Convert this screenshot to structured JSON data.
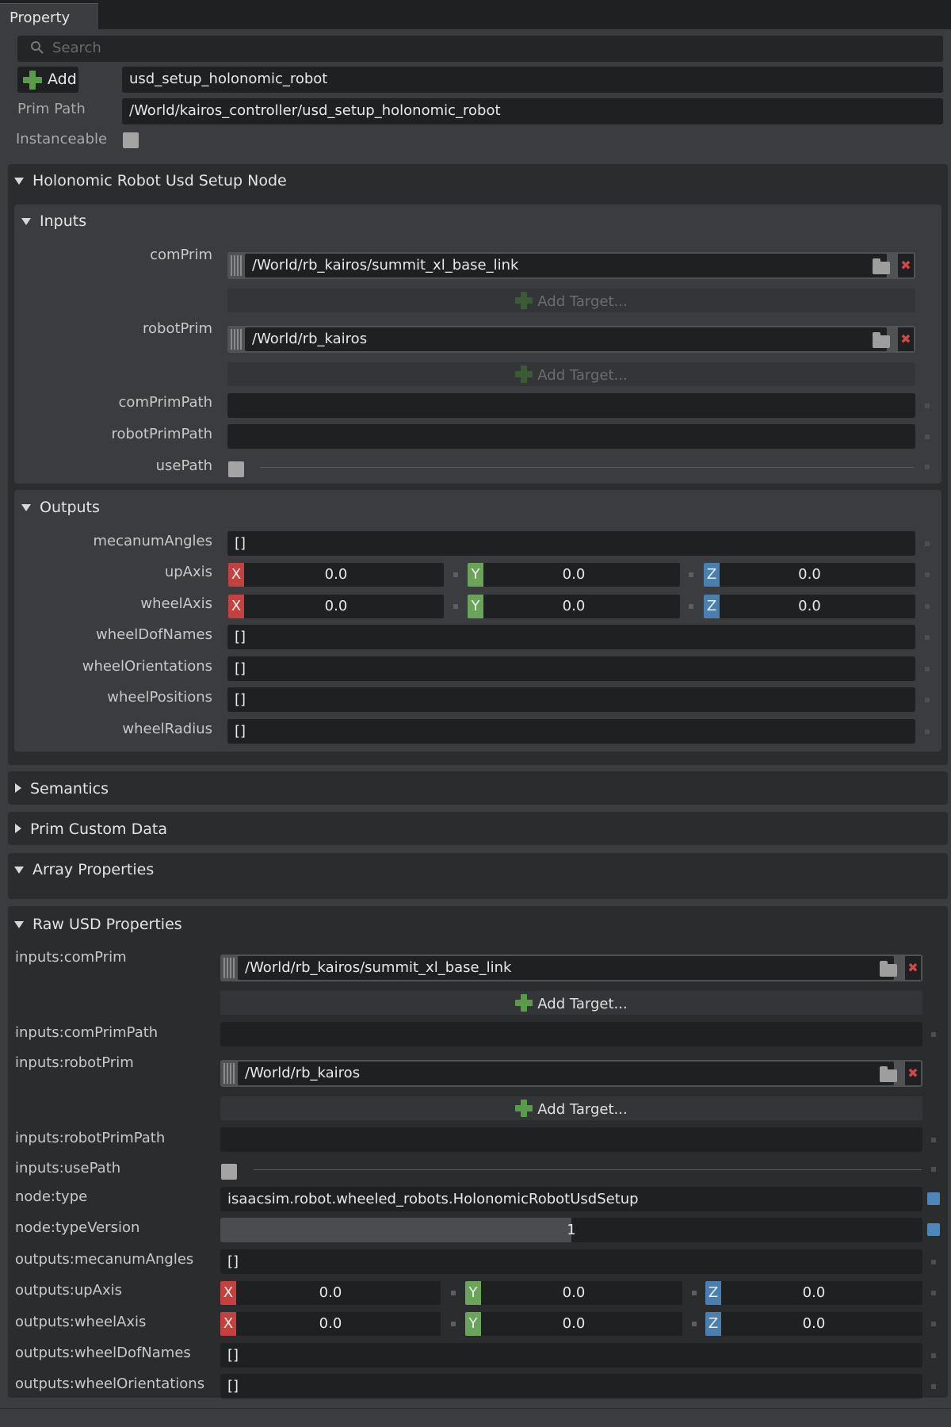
{
  "window": {
    "tab_label": "Property"
  },
  "header": {
    "search_placeholder": "Search",
    "add_label": "Add",
    "prim_name": "usd_setup_holonomic_robot",
    "prim_path_label": "Prim Path",
    "prim_path": "/World/kairos_controller/usd_setup_holonomic_robot",
    "instanceable_label": "Instanceable"
  },
  "node_section": {
    "title": "Holonomic Robot Usd Setup Node",
    "inputs": {
      "title": "Inputs",
      "com_prim_label": "comPrim",
      "com_prim_target": "/World/rb_kairos/summit_xl_base_link",
      "add_target_label": "Add Target...",
      "robot_prim_label": "robotPrim",
      "robot_prim_target": "/World/rb_kairos",
      "com_prim_path_label": "comPrimPath",
      "robot_prim_path_label": "robotPrimPath",
      "use_path_label": "usePath"
    },
    "outputs": {
      "title": "Outputs",
      "mecanum_angles_label": "mecanumAngles",
      "mecanum_angles_value": "[]",
      "up_axis_label": "upAxis",
      "up_axis": {
        "x": "0.0",
        "y": "0.0",
        "z": "0.0"
      },
      "wheel_axis_label": "wheelAxis",
      "wheel_axis": {
        "x": "0.0",
        "y": "0.0",
        "z": "0.0"
      },
      "wheel_dof_names_label": "wheelDofNames",
      "wheel_dof_names_value": "[]",
      "wheel_orientations_label": "wheelOrientations",
      "wheel_orientations_value": "[]",
      "wheel_positions_label": "wheelPositions",
      "wheel_positions_value": "[]",
      "wheel_radius_label": "wheelRadius",
      "wheel_radius_value": "[]"
    }
  },
  "collapsed_sections": {
    "semantics": "Semantics",
    "prim_custom_data": "Prim Custom Data",
    "array_properties": "Array Properties"
  },
  "raw_usd": {
    "title": "Raw USD Properties",
    "com_prim_label": "inputs:comPrim",
    "com_prim_target": "/World/rb_kairos/summit_xl_base_link",
    "add_target_label": "Add Target...",
    "com_prim_path_label": "inputs:comPrimPath",
    "robot_prim_label": "inputs:robotPrim",
    "robot_prim_target": "/World/rb_kairos",
    "robot_prim_path_label": "inputs:robotPrimPath",
    "use_path_label": "inputs:usePath",
    "node_type_label": "node:type",
    "node_type_value": "isaacsim.robot.wheeled_robots.HolonomicRobotUsdSetup",
    "node_type_version_label": "node:typeVersion",
    "node_type_version_value": "1",
    "node_type_version_fill": 0.5,
    "mecanum_angles_label": "outputs:mecanumAngles",
    "mecanum_angles_value": "[]",
    "up_axis_label": "outputs:upAxis",
    "up_axis": {
      "x": "0.0",
      "y": "0.0",
      "z": "0.0"
    },
    "wheel_axis_label": "outputs:wheelAxis",
    "wheel_axis": {
      "x": "0.0",
      "y": "0.0",
      "z": "0.0"
    },
    "wheel_dof_names_label": "outputs:wheelDofNames",
    "wheel_dof_names_value": "[]",
    "wheel_orientations_label": "outputs:wheelOrientations",
    "wheel_orientations_value": "[]"
  },
  "colors": {
    "axis_x": "#c4413f",
    "axis_y": "#6aa35a",
    "axis_z": "#4a7fb0",
    "accent_blue": "#4f86b8",
    "add_green": "#5a9a4a"
  }
}
